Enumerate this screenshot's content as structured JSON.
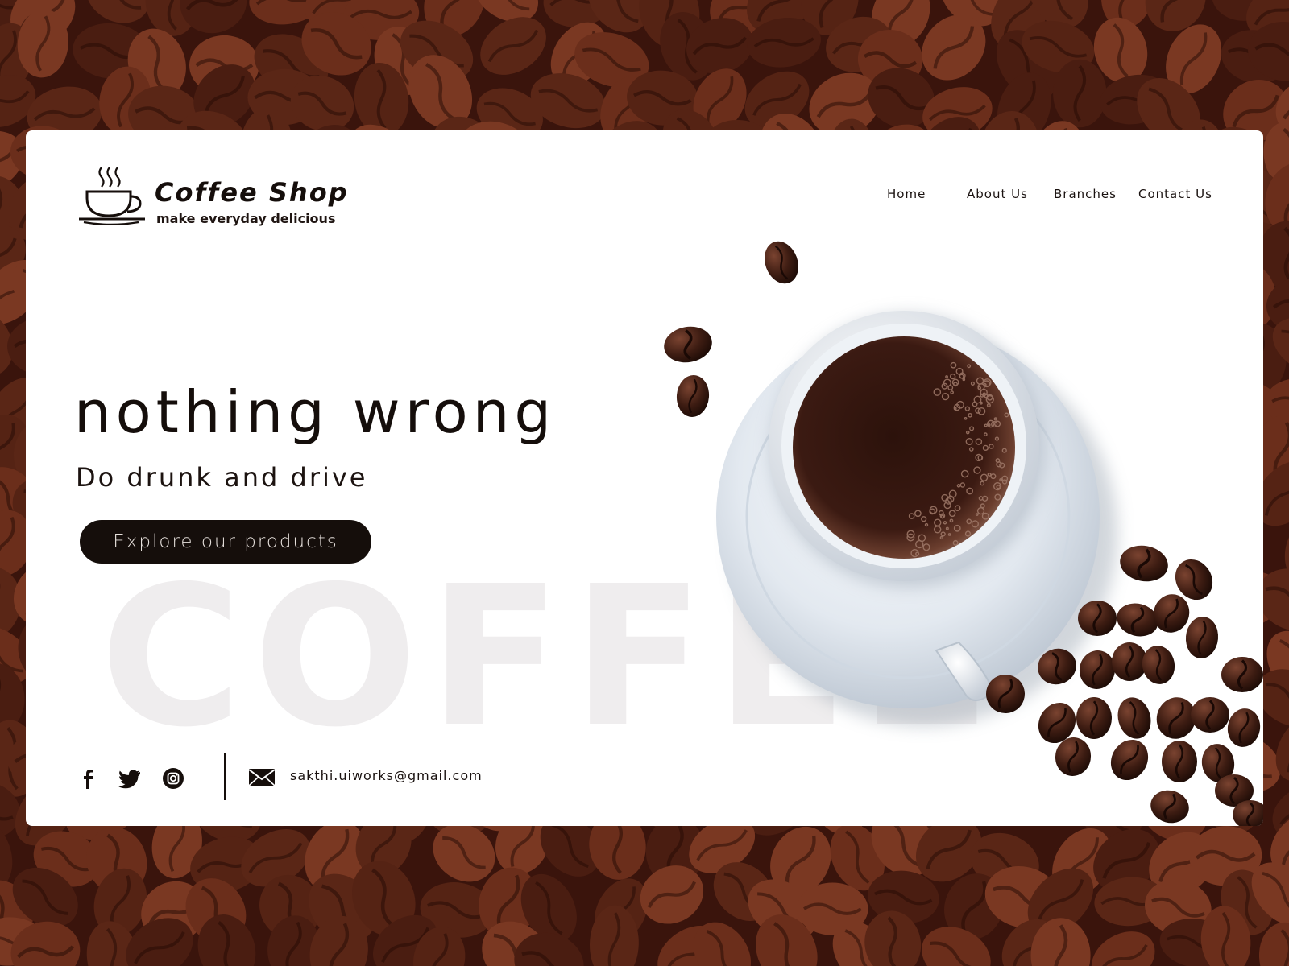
{
  "brand": {
    "name": "Coffee Shop",
    "tagline": "make everyday delicious",
    "logo_icon": "coffee-cup-icon"
  },
  "nav": {
    "items": [
      {
        "label": "Home"
      },
      {
        "label": "About Us"
      },
      {
        "label": "Branches"
      },
      {
        "label": "Contact Us"
      }
    ]
  },
  "hero": {
    "title": "nothing wrong",
    "subtitle": "Do drunk and drive",
    "cta_label": "Explore our products",
    "watermark": "COFFEE"
  },
  "footer": {
    "social": [
      {
        "icon": "facebook-icon"
      },
      {
        "icon": "twitter-icon"
      },
      {
        "icon": "instagram-icon"
      }
    ],
    "mail_icon": "mail-icon",
    "email": "sakthi.uiworks@gmail.com"
  },
  "colors": {
    "background_beans": "#3a140c",
    "card": "#ffffff",
    "primary_dark": "#150e0b",
    "watermark": "#efedee",
    "cta_text": "#e6e0dc",
    "coffee": "#3b1a12",
    "saucer": "#dfe6ee"
  }
}
